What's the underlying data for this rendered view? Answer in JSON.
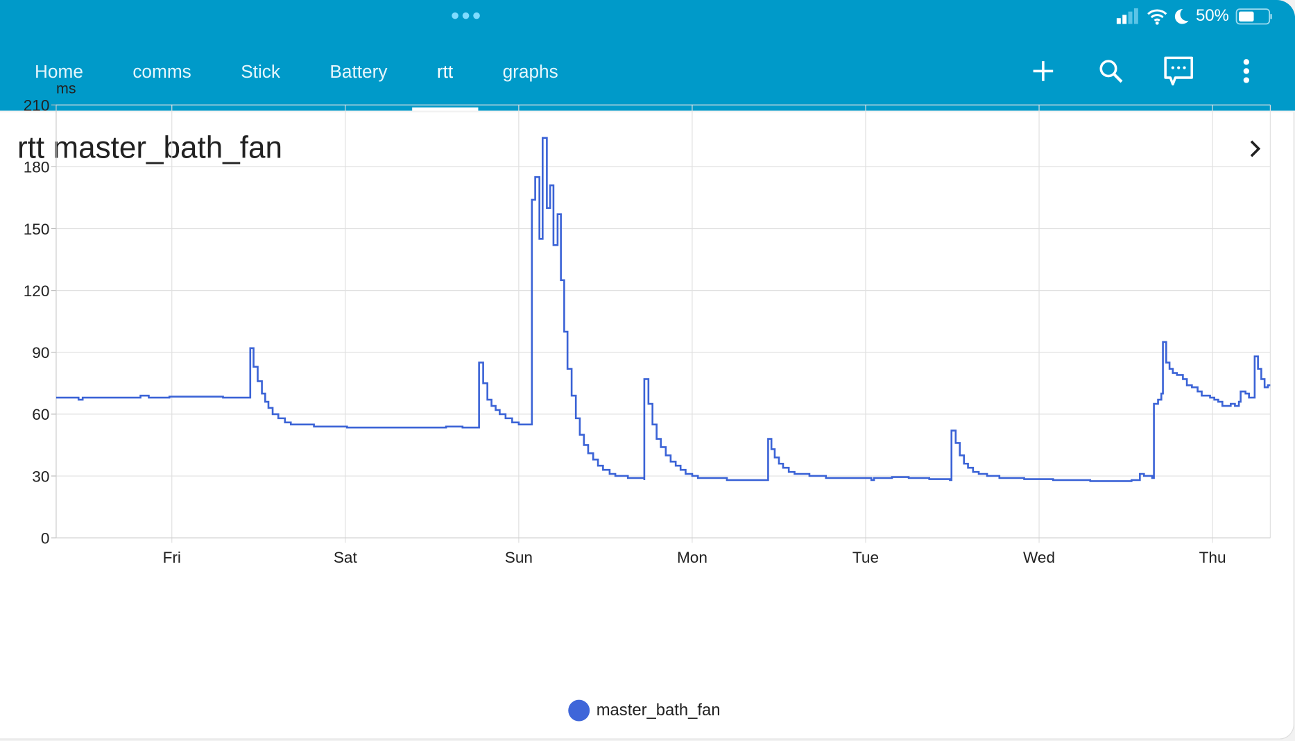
{
  "status_bar": {
    "battery_percent": "50%"
  },
  "tabs": [
    {
      "label": "Home",
      "active": false
    },
    {
      "label": "comms",
      "active": false
    },
    {
      "label": "Stick",
      "active": false
    },
    {
      "label": "Battery",
      "active": false
    },
    {
      "label": "rtt",
      "active": true
    },
    {
      "label": "graphs",
      "active": false
    }
  ],
  "card": {
    "title": "rtt master_bath_fan"
  },
  "colors": {
    "accent": "#009ac9",
    "series": "#3b63d6"
  },
  "chart_data": {
    "type": "line",
    "step": true,
    "ylabel": "ms",
    "ylim": [
      0,
      210
    ],
    "yticks": [
      0,
      30,
      60,
      90,
      120,
      150,
      180,
      210
    ],
    "xlim_days": [
      0.333,
      7.333
    ],
    "xticks": [
      {
        "t": 1,
        "label": "Fri"
      },
      {
        "t": 2,
        "label": "Sat"
      },
      {
        "t": 3,
        "label": "Sun"
      },
      {
        "t": 4,
        "label": "Mon"
      },
      {
        "t": 5,
        "label": "Tue"
      },
      {
        "t": 6,
        "label": "Wed"
      },
      {
        "t": 7,
        "label": "Thu"
      }
    ],
    "grid": true,
    "legend_position": "bottom-center",
    "series": [
      {
        "name": "master_bath_fan",
        "color": "#3b63d6",
        "x": [
          0.333,
          0.462,
          0.486,
          0.819,
          0.867,
          0.986,
          1.295,
          1.452,
          1.452,
          1.471,
          1.495,
          1.519,
          1.538,
          1.557,
          1.581,
          1.614,
          1.652,
          1.686,
          1.748,
          1.819,
          2.01,
          2.295,
          2.581,
          2.676,
          2.771,
          2.771,
          2.795,
          2.819,
          2.843,
          2.867,
          2.89,
          2.924,
          2.962,
          3.0,
          3.076,
          3.076,
          3.095,
          3.119,
          3.138,
          3.162,
          3.181,
          3.2,
          3.224,
          3.243,
          3.262,
          3.281,
          3.305,
          3.329,
          3.352,
          3.376,
          3.4,
          3.429,
          3.457,
          3.486,
          3.524,
          3.557,
          3.629,
          3.724,
          3.724,
          3.748,
          3.771,
          3.795,
          3.819,
          3.848,
          3.876,
          3.905,
          3.933,
          3.962,
          4.0,
          4.033,
          4.2,
          4.438,
          4.438,
          4.457,
          4.476,
          4.5,
          4.524,
          4.557,
          4.59,
          4.676,
          4.771,
          4.914,
          5.033,
          5.048,
          5.152,
          5.248,
          5.367,
          5.486,
          5.495,
          5.519,
          5.543,
          5.567,
          5.59,
          5.619,
          5.652,
          5.7,
          5.771,
          5.914,
          6.081,
          6.295,
          6.533,
          6.581,
          6.605,
          6.652,
          6.662,
          6.686,
          6.705,
          6.714,
          6.733,
          6.752,
          6.771,
          6.795,
          6.829,
          6.852,
          6.881,
          6.914,
          6.938,
          6.986,
          7.01,
          7.033,
          7.057,
          7.105,
          7.129,
          7.152,
          7.162,
          7.19,
          7.21,
          7.229,
          7.243,
          7.262,
          7.281,
          7.3,
          7.319,
          7.333
        ],
        "y": [
          68,
          67,
          68,
          69,
          68,
          68.5,
          68,
          68,
          92,
          83,
          76,
          70,
          66,
          63,
          60,
          58,
          56,
          55,
          55,
          54,
          53.5,
          53.5,
          54,
          53.5,
          54,
          85,
          75,
          67,
          64,
          62,
          60,
          58,
          56,
          55,
          55,
          164,
          175,
          145,
          194,
          160,
          171,
          142,
          157,
          125,
          100,
          82,
          69,
          58,
          50,
          45,
          41,
          38,
          35,
          33,
          31,
          30,
          29,
          28,
          77,
          65,
          55,
          48,
          44,
          40,
          37,
          35,
          33,
          31,
          30,
          29,
          28,
          28,
          48,
          43,
          39,
          36,
          34,
          32,
          31,
          30,
          29,
          29,
          28,
          29,
          29.5,
          29,
          28.5,
          28,
          52,
          46,
          40,
          36,
          34,
          32,
          31,
          30,
          29,
          28.5,
          28,
          27.5,
          28,
          31,
          30,
          29,
          65,
          67,
          70,
          95,
          85,
          82,
          80,
          79,
          77,
          74,
          73,
          71,
          69,
          68,
          67,
          66,
          64,
          65,
          64,
          66,
          71,
          70,
          68,
          68,
          88,
          82,
          77,
          73,
          74,
          74
        ]
      }
    ]
  }
}
